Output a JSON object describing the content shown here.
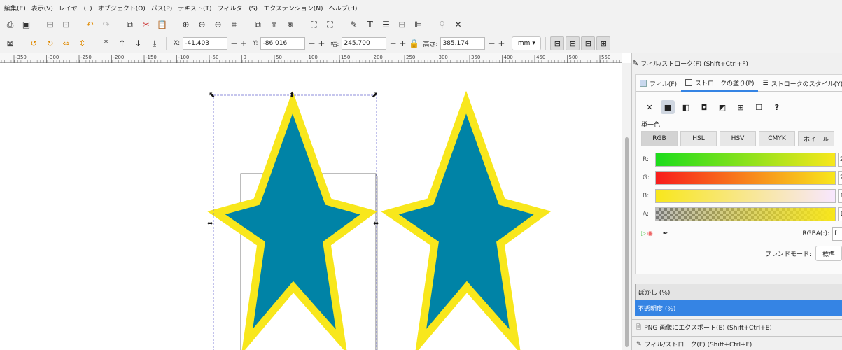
{
  "menu": [
    "編集(E)",
    "表示(V)",
    "レイヤー(L)",
    "オブジェクト(O)",
    "パス(P)",
    "テキスト(T)",
    "フィルター(S)",
    "エクステンション(N)",
    "ヘルプ(H)"
  ],
  "toolbar": {
    "x_label": "X:",
    "x_value": "-41.403",
    "y_label": "Y:",
    "y_value": "-86.016",
    "w_label": "幅:",
    "w_value": "245.700",
    "h_label": "高さ:",
    "h_value": "385.174",
    "unit": "mm"
  },
  "ruler": {
    "labels": [
      "-350",
      "-300",
      "-250",
      "-200",
      "-150",
      "-100",
      "-50",
      "0",
      "50",
      "100",
      "150",
      "200",
      "250",
      "300",
      "350",
      "400",
      "450",
      "500",
      "550"
    ]
  },
  "panel": {
    "title": "フィル/ストローク(F) (Shift+Ctrl+F)",
    "tabs": {
      "fill": "フィル(F)",
      "stroke_paint": "ストロークの塗り(P)",
      "stroke_style": "ストロークのスタイル(Y)"
    },
    "unknown_mark": "?",
    "flat_color_label": "単一色",
    "modes": [
      "RGB",
      "HSL",
      "HSV",
      "CMYK",
      "ホイール"
    ],
    "sliders": {
      "r_label": "R:",
      "r_value": "2",
      "g_label": "G:",
      "g_value": "2",
      "b_label": "B:",
      "b_value": "1",
      "a_label": "A:",
      "a_value": "1"
    },
    "rgba_label": "RGBA(:):",
    "rgba_value": "f",
    "blend_label": "ブレンドモード:",
    "blend_value": "標準",
    "blur_label": "ぼかし (%)",
    "opacity_label": "不透明度 (%)",
    "png_export_title": "PNG 画像にエクスポート(E) (Shift+Ctrl+E)",
    "fill_stroke_title_2": "フィル/ストローク(F) (Shift+Ctrl+F)"
  },
  "colors": {
    "star_fill": "#0083a6",
    "star_stroke": "#f8e71c",
    "selection": "#6a6ad0",
    "accent": "#3584e4"
  }
}
